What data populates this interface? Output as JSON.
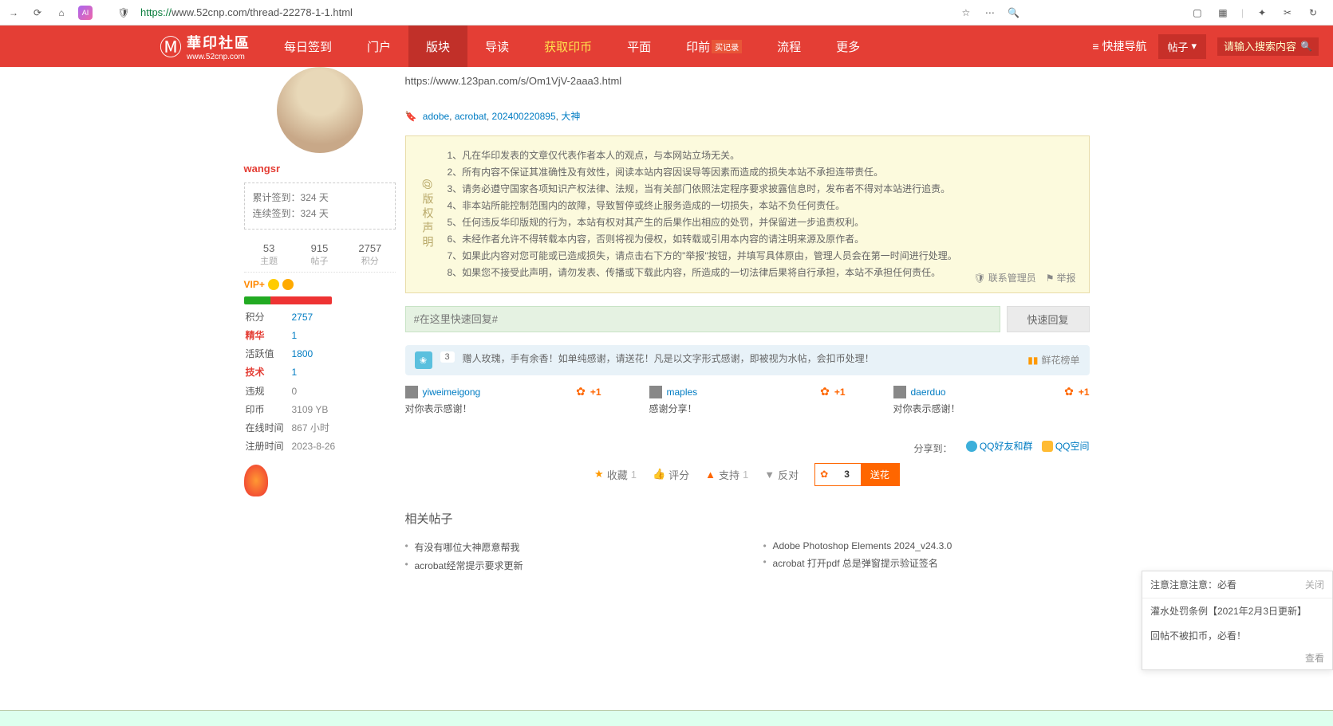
{
  "browser": {
    "url_prefix": "https://",
    "url_rest": "www.52cnp.com/thread-22278-1-1.html"
  },
  "logo": {
    "title": "華印社區",
    "sub": "www.52cnp.com"
  },
  "nav": {
    "items": [
      "每日签到",
      "门户",
      "版块",
      "导读",
      "获取印币",
      "平面",
      "印前",
      "流程",
      "更多"
    ],
    "badge": "买记录",
    "quick": "快捷导航",
    "tiezi": "帖子",
    "search_ph": "请输入搜索内容"
  },
  "thread_url": "https://www.123pan.com/s/Om1VjV-2aaa3.html",
  "tags": [
    "adobe",
    "acrobat",
    "202400220895",
    "大神"
  ],
  "user": {
    "name": "wangsr",
    "signin_total_label": "累计签到：",
    "signin_total": "324 天",
    "signin_cont_label": "连续签到：",
    "signin_cont": "324 天",
    "stats": [
      {
        "n": "53",
        "l": "主题"
      },
      {
        "n": "915",
        "l": "帖子"
      },
      {
        "n": "2757",
        "l": "积分"
      }
    ],
    "vip_label": "VIP+",
    "info": [
      {
        "k": "积分",
        "v": "2757",
        "red": false
      },
      {
        "k": "精华",
        "v": "1",
        "red": true
      },
      {
        "k": "活跃值",
        "v": "1800",
        "red": false
      },
      {
        "k": "技术",
        "v": "1",
        "red": true
      },
      {
        "k": "违规",
        "v": "0",
        "red": false,
        "gray": true
      },
      {
        "k": "印币",
        "v": "3109 YB",
        "red": false,
        "gray": true
      },
      {
        "k": "在线时间",
        "v": "867 小时",
        "red": false,
        "gray": true
      },
      {
        "k": "注册时间",
        "v": "2023-8-26",
        "red": false,
        "gray": true
      }
    ]
  },
  "disclaimer": {
    "title": "@版权声明",
    "lines": [
      "1、凡在华印发表的文章仅代表作者本人的观点，与本网站立场无关。",
      "2、所有内容不保证其准确性及有效性，阅读本站内容因误导等因素而造成的损失本站不承担连带责任。",
      "3、请务必遵守国家各项知识产权法律、法规，当有关部门依照法定程序要求披露信息时，发布者不得对本站进行追责。",
      "4、非本站所能控制范围内的故障，导致暂停或终止服务造成的一切损失，本站不负任何责任。",
      "5、任何违反华印版规的行为，本站有权对其产生的后果作出相应的处罚，并保留进一步追责权利。",
      "6、未经作者允许不得转载本内容，否则将视为侵权，如转载或引用本内容的请注明来源及原作者。",
      "7、如果此内容对您可能或已造成损失，请点击右下方的\"举报\"按钮，并填写具体原由，管理人员会在第一时间进行处理。",
      "8、如果您不接受此声明，请勿发表、传播或下载此内容，所造成的一切法律后果将自行承担，本站不承担任何责任。"
    ],
    "contact": "联系管理员",
    "report": "举报"
  },
  "quickreply": {
    "ph": "#在这里快速回复#",
    "btn": "快速回复"
  },
  "flower_box": {
    "count": "3",
    "text": "赠人玫瑰，手有余香！如单纯感谢，请送花！凡是以文字形式感谢，即被视为水帖，会扣币处理！",
    "rank": "鲜花榜单"
  },
  "senders": [
    {
      "name": "yiweimeigong",
      "plus": "+1",
      "msg": "对你表示感谢！"
    },
    {
      "name": "maples",
      "plus": "+1",
      "msg": "感谢分享！"
    },
    {
      "name": "daerduo",
      "plus": "+1",
      "msg": "对你表示感谢！"
    }
  ],
  "share": {
    "label": "分享到：",
    "qq": "QQ好友和群",
    "qzone": "QQ空间"
  },
  "actions": {
    "fav": "收藏",
    "fav_n": "1",
    "rate": "评分",
    "support": "支持",
    "support_n": "1",
    "oppose": "反对",
    "flower_n": "3",
    "flower_btn": "送花"
  },
  "related": {
    "title": "相关帖子",
    "left": [
      "有没有哪位大神愿意帮我",
      "acrobat经常提示要求更新"
    ],
    "right": [
      "Adobe Photoshop Elements 2024_v24.3.0",
      "acrobat 打开pdf 总是弹窗提示验证签名"
    ]
  },
  "notice": {
    "hdr": "注意注意注意：必看",
    "close": "关闭",
    "items": [
      "灌水处罚条例【2021年2月3日更新】",
      "回帖不被扣币，必看！"
    ],
    "ftr": "查看"
  }
}
